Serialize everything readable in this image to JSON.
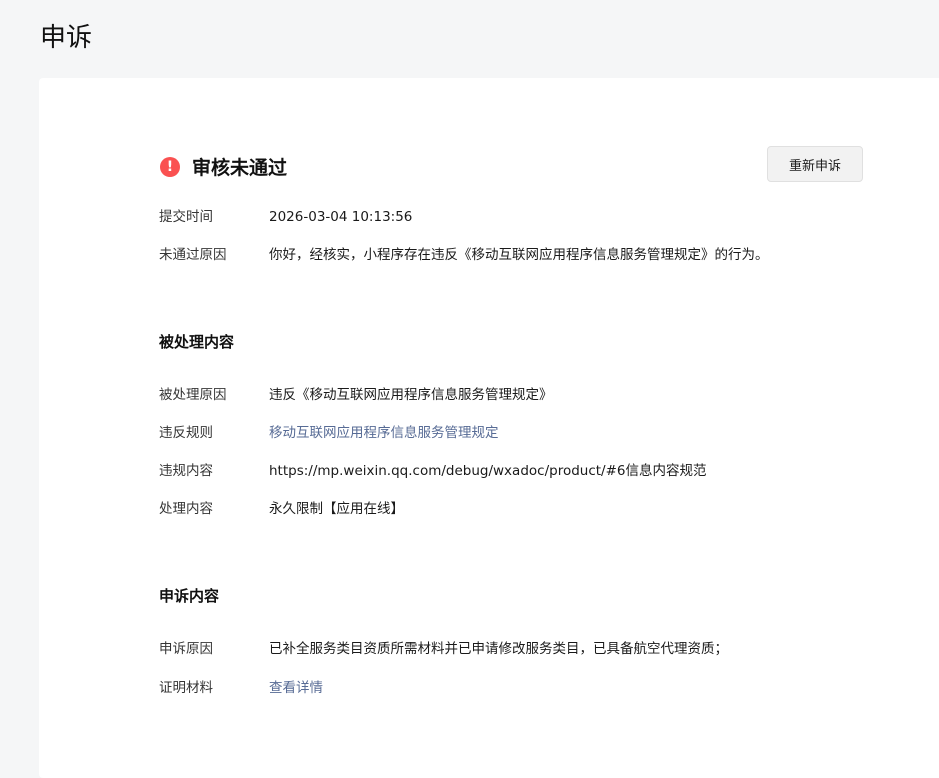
{
  "page": {
    "title": "申诉"
  },
  "status": {
    "icon": "alert-icon",
    "icon_glyph": "!",
    "icon_color": "#fa5151",
    "title": "审核未通过",
    "reapply_label": "重新申诉",
    "rows": [
      {
        "label": "提交时间",
        "value": "2026-03-04 10:13:56"
      },
      {
        "label": "未通过原因",
        "value": "你好，经核实，小程序存在违反《移动互联网应用程序信息服务管理规定》的行为。"
      }
    ]
  },
  "processed": {
    "title": "被处理内容",
    "rows": [
      {
        "label": "被处理原因",
        "value": "违反《移动互联网应用程序信息服务管理规定》"
      },
      {
        "label": "违反规则",
        "value": "移动互联网应用程序信息服务管理规定"
      },
      {
        "label": "违规内容",
        "value": "https://mp.weixin.qq.com/debug/wxadoc/product/#6信息内容规范"
      },
      {
        "label": "处理内容",
        "value": "永久限制【应用在线】"
      }
    ]
  },
  "appeal": {
    "title": "申诉内容",
    "rows": [
      {
        "label": "申诉原因",
        "value": "已补全服务类目资质所需材料并已申请修改服务类目，已具备航空代理资质；"
      },
      {
        "label": "证明材料",
        "value": "查看详情"
      }
    ]
  },
  "colors": {
    "link": "#576b95",
    "background": "#f5f6f7",
    "card": "#ffffff"
  }
}
